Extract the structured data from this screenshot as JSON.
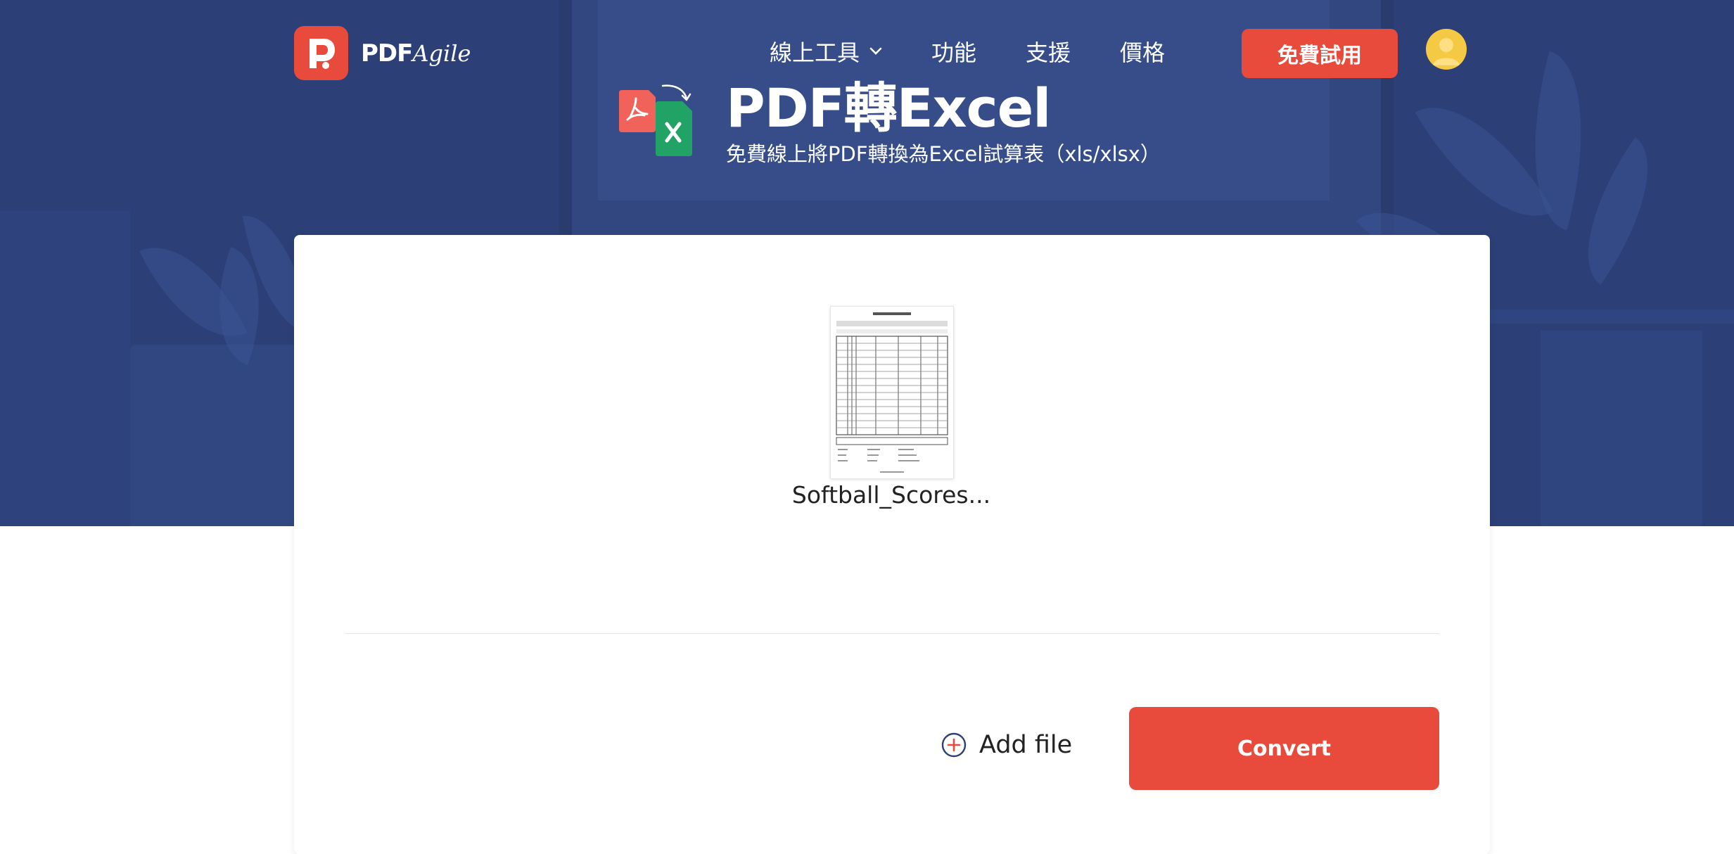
{
  "brand": {
    "name_bold": "PDF",
    "name_script": "Agile"
  },
  "nav": {
    "items": [
      {
        "label": "線上工具"
      },
      {
        "label": "功能"
      },
      {
        "label": "支援"
      },
      {
        "label": "價格"
      }
    ],
    "trial_button": "免費試用"
  },
  "hero": {
    "title": "PDF轉Excel",
    "subtitle": "免費線上將PDF轉換為Excel試算表（xls/xlsx）"
  },
  "upload": {
    "file_name": "Softball_Scores...",
    "add_file_label": "Add file",
    "convert_label": "Convert"
  },
  "icons": {
    "logo": "pdf-agile-logo-icon",
    "chevron": "chevron-down-icon",
    "avatar": "user-avatar-icon",
    "convert": "pdf-to-excel-icon",
    "add": "plus-circle-icon"
  },
  "colors": {
    "accent": "#e84a3c",
    "hero_bg": "#2c3f76",
    "excel_green": "#21a366",
    "pdf_red": "#f0625a",
    "avatar_yellow": "#f6c944"
  }
}
